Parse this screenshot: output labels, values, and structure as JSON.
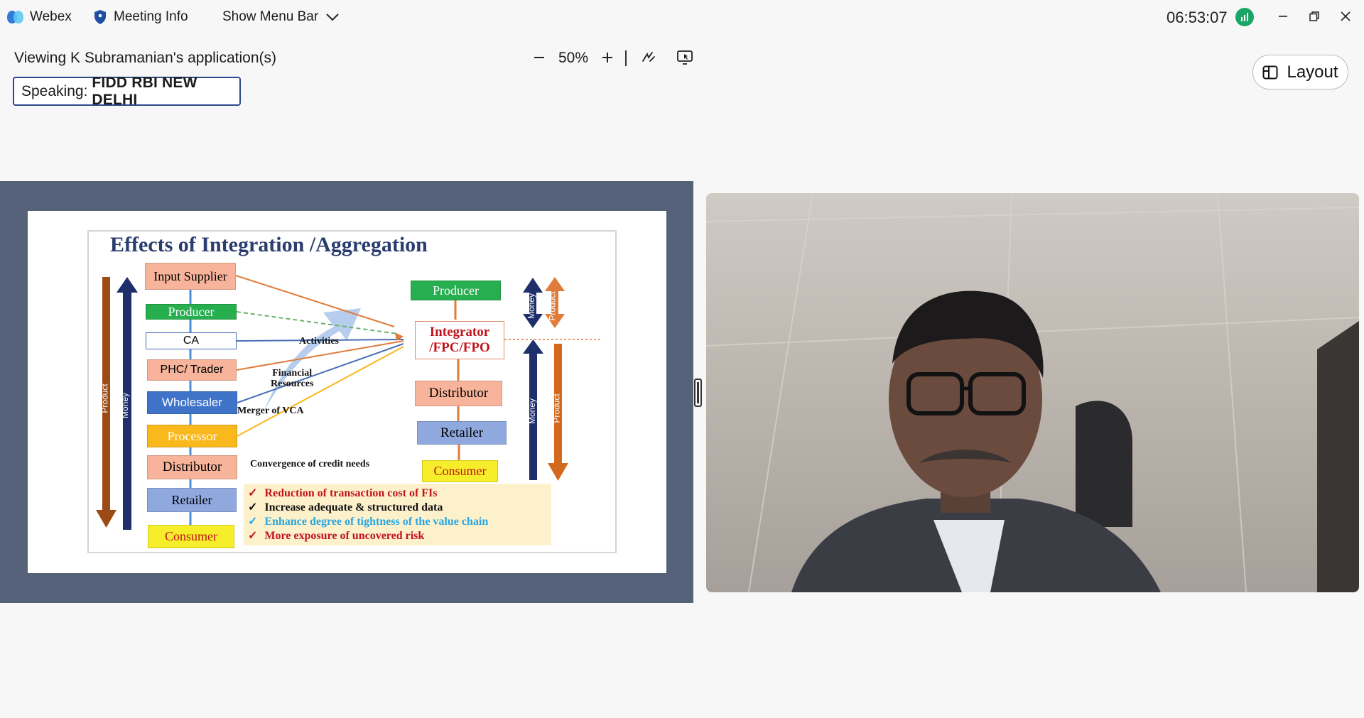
{
  "titlebar": {
    "app_name": "Webex",
    "meeting_info_label": "Meeting Info",
    "show_menu_label": "Show Menu Bar",
    "clock": "06:53:07"
  },
  "share_toolbar": {
    "viewing_text": "Viewing K Subramanian's application(s)",
    "zoom_level": "50%"
  },
  "speaking": {
    "prefix": "Speaking:",
    "name": "FIDD RBI NEW DELHI"
  },
  "layout_button": {
    "label": "Layout"
  },
  "slide": {
    "title": "Effects of Integration /Aggregation",
    "left_chain": [
      {
        "label": "Input Supplier",
        "color": "#f7b49a"
      },
      {
        "label": "Producer",
        "color": "#27ae4f"
      },
      {
        "label": "CA",
        "color": "#ffffff"
      },
      {
        "label": "PHC/ Trader",
        "color": "#f7b49a"
      },
      {
        "label": "Wholesaler",
        "color": "#3f73c8"
      },
      {
        "label": "Processor",
        "color": "#f9b81c"
      },
      {
        "label": "Distributor",
        "color": "#f7b49a"
      },
      {
        "label": "Retailer",
        "color": "#8fa9df"
      },
      {
        "label": "Consumer",
        "color": "#f6ee2a"
      }
    ],
    "right_chain": [
      {
        "label": "Producer",
        "color": "#27ae4f"
      },
      {
        "label": "Integrator\n/FPC/FPO",
        "color": "#ffffff"
      },
      {
        "label": "Distributor",
        "color": "#f7b49a"
      },
      {
        "label": "Retailer",
        "color": "#8fa9df"
      },
      {
        "label": "Consumer",
        "color": "#f6ee2a"
      }
    ],
    "arrow_labels": {
      "product": "Product",
      "money": "Money"
    },
    "annotations": {
      "activities": "Activities",
      "financial_resources": "Financial\nResources",
      "merger": "Merger of VCA",
      "convergence": "Convergence of credit needs"
    },
    "benefits": [
      {
        "text": "Reduction of transaction cost of FIs",
        "color": "#c0141c"
      },
      {
        "text": "Increase adequate & structured data",
        "color": "#111111"
      },
      {
        "text": "Enhance degree of tightness of the value chain",
        "color": "#2aa6e0"
      },
      {
        "text": "More exposure of uncovered risk",
        "color": "#c0141c"
      }
    ]
  },
  "colors": {
    "share_background": "#566279",
    "product_arrow": "#d2691e",
    "money_arrow": "#1e2f6b",
    "title": "#2a3d6e",
    "signal": "#1aa566"
  }
}
